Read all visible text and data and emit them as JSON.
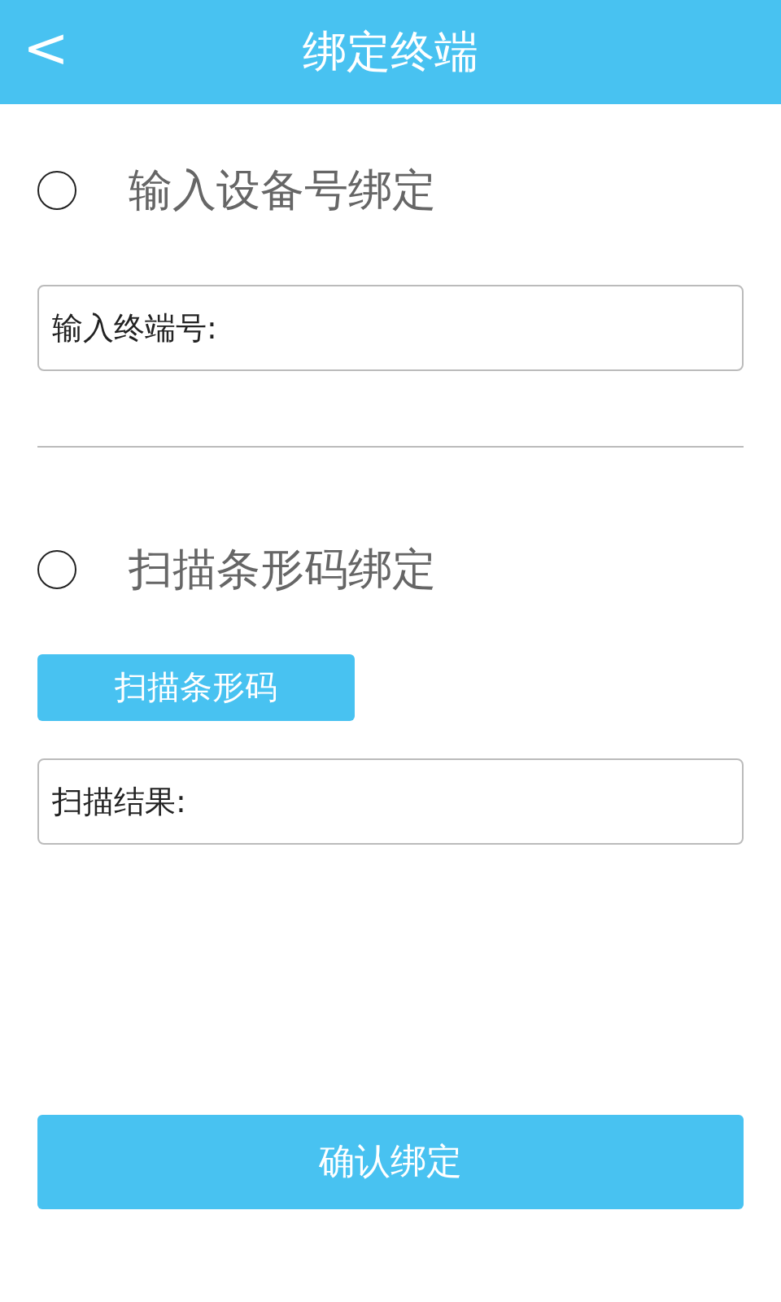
{
  "header": {
    "back": "<",
    "title": "绑定终端"
  },
  "options": [
    {
      "kind": "input",
      "label": "输入设备号绑定",
      "selected": false,
      "field_label": "输入终端号:"
    },
    {
      "kind": "scan",
      "label": "扫描条形码绑定",
      "selected": false,
      "button": "扫描条形码",
      "field_label": "扫描结果:"
    }
  ],
  "confirm_button": "确认绑定"
}
